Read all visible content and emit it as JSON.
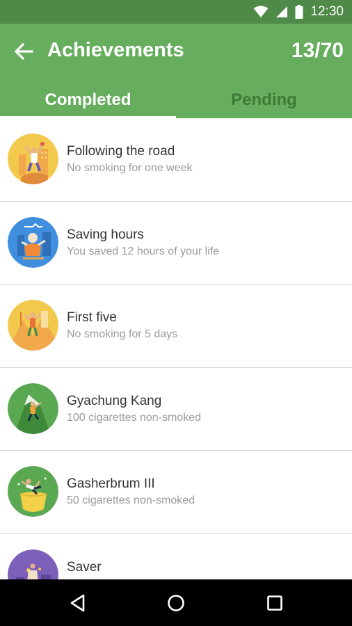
{
  "status_bar": {
    "time": "12:30",
    "icons": [
      "wifi-icon",
      "signal-icon",
      "battery-icon"
    ]
  },
  "header": {
    "back_icon": "arrow-back-icon",
    "title": "Achievements",
    "counter": "13/70"
  },
  "tabs": [
    {
      "label": "Completed",
      "active": true
    },
    {
      "label": "Pending",
      "active": false
    }
  ],
  "achievements": [
    {
      "name": "Following the road",
      "description": "No smoking for one week",
      "badge_color": "#f2c94c",
      "badge_icon": "hiker-celebrating-icon"
    },
    {
      "name": "Saving hours",
      "description": "You saved 12 hours of your life",
      "badge_color": "#3f8fde",
      "badge_icon": "person-saving-time-icon"
    },
    {
      "name": "First five",
      "description": "No smoking for 5 days",
      "badge_color": "#f2c94c",
      "badge_icon": "climber-icon"
    },
    {
      "name": "Gyachung Kang",
      "description": "100 cigarettes non-smoked",
      "badge_color": "#5aa852",
      "badge_icon": "mountain-climber-icon"
    },
    {
      "name": "Gasherbrum III",
      "description": "50 cigarettes non-smoked",
      "badge_color": "#5aa852",
      "badge_icon": "jumping-person-icon"
    },
    {
      "name": "Saver",
      "description": "",
      "badge_color": "#7b5fb8",
      "badge_icon": "saver-icon"
    }
  ],
  "nav_bar": {
    "icons": [
      "back-triangle-icon",
      "home-circle-icon",
      "recents-square-icon"
    ]
  },
  "colors": {
    "status_bar": "#4f8a48",
    "app_bar": "#66ae5d",
    "tab_inactive": "#3e7a37"
  }
}
